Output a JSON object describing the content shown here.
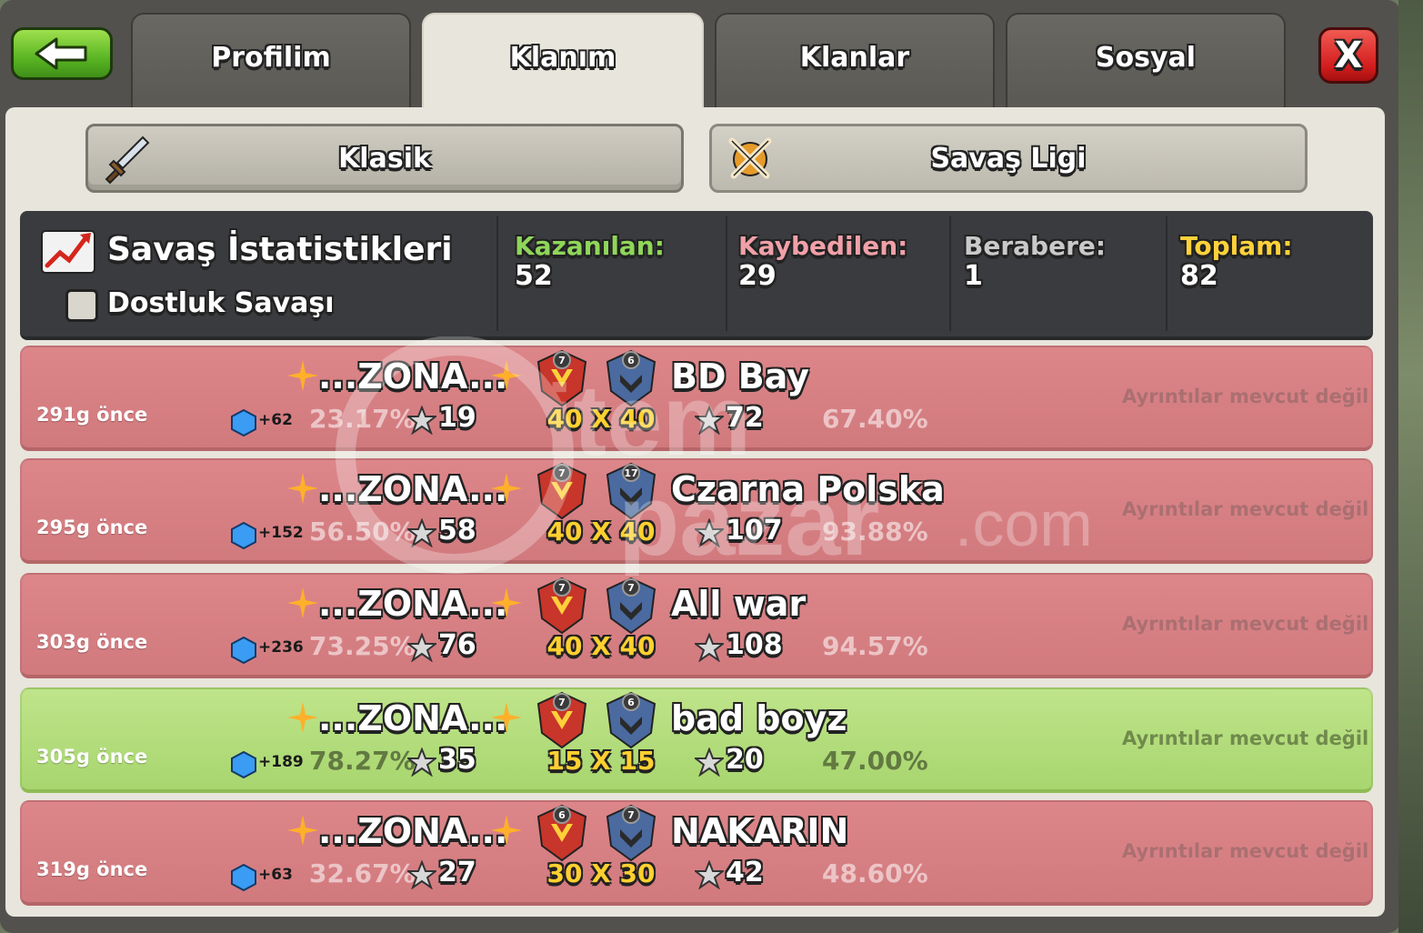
{
  "navigation": {
    "tabs": [
      {
        "label": "Profilim"
      },
      {
        "label": "Klanım"
      },
      {
        "label": "Klanlar"
      },
      {
        "label": "Sosyal"
      }
    ],
    "active_tab": "Klanım",
    "close_label": "X"
  },
  "war_type_tabs": {
    "classic": "Klasik",
    "league": "Savaş Ligi"
  },
  "stats": {
    "title": "Savaş İstatistikleri",
    "friendly_label": "Dostluk Savaşı",
    "won_label": "Kazanılan:",
    "won_value": "52",
    "lost_label": "Kaybedilen:",
    "lost_value": "29",
    "draw_label": "Berabere:",
    "draw_value": "1",
    "total_label": "Toplam:",
    "total_value": "82"
  },
  "wars": [
    {
      "ago": "291g önce",
      "xp": "+62",
      "clan": "...ZONA...",
      "clan_pct": "23.17%",
      "clan_stars": "19",
      "size": "40 X 40",
      "enemy": "BD Bay",
      "enemy_stars": "72",
      "enemy_pct": "67.40%",
      "detail": "Ayrıntılar mevcut değil",
      "result": "lost",
      "clan_level": "7",
      "enemy_level": "6"
    },
    {
      "ago": "295g önce",
      "xp": "+152",
      "clan": "...ZONA...",
      "clan_pct": "56.50%",
      "clan_stars": "58",
      "size": "40 X 40",
      "enemy": "Czarna Polska",
      "enemy_stars": "107",
      "enemy_pct": "93.88%",
      "detail": "Ayrıntılar mevcut değil",
      "result": "lost",
      "clan_level": "7",
      "enemy_level": "17"
    },
    {
      "ago": "303g önce",
      "xp": "+236",
      "clan": "...ZONA...",
      "clan_pct": "73.25%",
      "clan_stars": "76",
      "size": "40 X 40",
      "enemy": "All war",
      "enemy_stars": "108",
      "enemy_pct": "94.57%",
      "detail": "Ayrıntılar mevcut değil",
      "result": "lost",
      "clan_level": "7",
      "enemy_level": "7"
    },
    {
      "ago": "305g önce",
      "xp": "+189",
      "clan": "...ZONA...",
      "clan_pct": "78.27%",
      "clan_stars": "35",
      "size": "15 X 15",
      "enemy": "bad boyz",
      "enemy_stars": "20",
      "enemy_pct": "47.00%",
      "detail": "Ayrıntılar mevcut değil",
      "result": "won",
      "clan_level": "7",
      "enemy_level": "6"
    },
    {
      "ago": "319g önce",
      "xp": "+63",
      "clan": "...ZONA...",
      "clan_pct": "32.67%",
      "clan_stars": "27",
      "size": "30 X 30",
      "enemy": "NAKARIN",
      "enemy_stars": "42",
      "enemy_pct": "48.60%",
      "detail": "Ayrıntılar mevcut değil",
      "result": "lost",
      "clan_level": "6",
      "enemy_level": "7"
    }
  ],
  "watermark": {
    "brand_top": "item",
    "brand_bottom": "pazar",
    "suffix": ".com"
  },
  "colors": {
    "won_row": "#a8d66f",
    "lost_row": "#d17a7e",
    "won_label": "#8fd65a",
    "lost_label": "#f0a0a8",
    "draw_label": "#c9c9c9",
    "total_label": "#ffd23a",
    "war_size": "#ffd030"
  }
}
